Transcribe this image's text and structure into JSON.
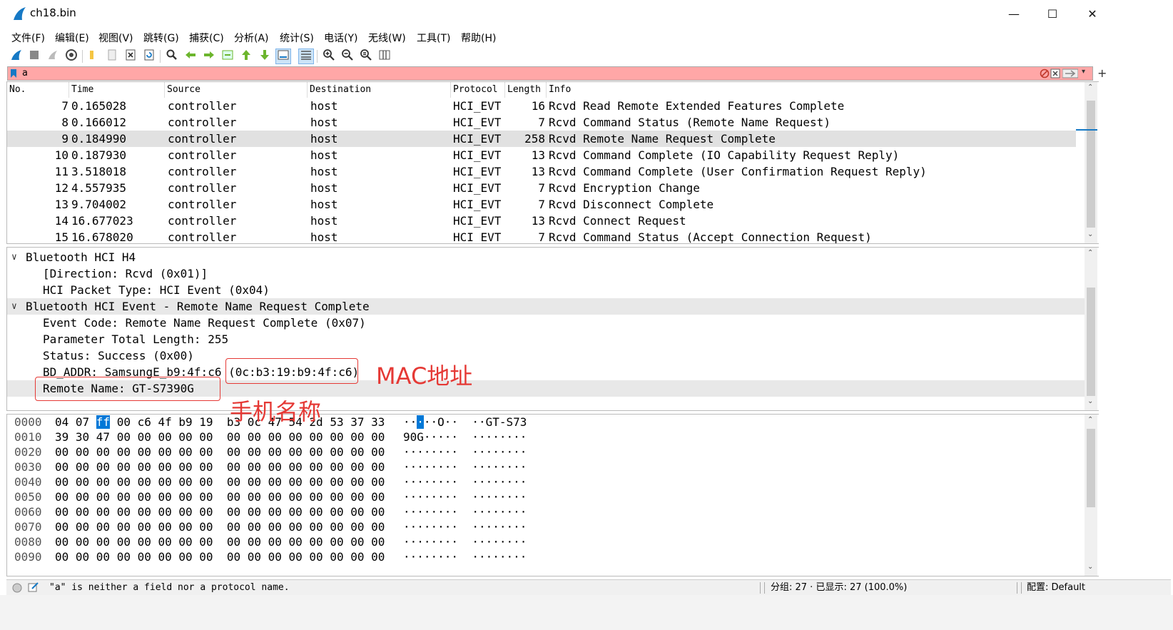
{
  "window": {
    "title": "ch18.bin"
  },
  "menu": [
    "文件(F)",
    "编辑(E)",
    "视图(V)",
    "跳转(G)",
    "捕获(C)",
    "分析(A)",
    "统计(S)",
    "电话(Y)",
    "无线(W)",
    "工具(T)",
    "帮助(H)"
  ],
  "filter": {
    "value": "a"
  },
  "columns": [
    "No.",
    "Time",
    "Source",
    "Destination",
    "Protocol",
    "Length",
    "Info"
  ],
  "packets": [
    {
      "no": "7",
      "time": "0.165028",
      "source": "controller",
      "destination": "host",
      "protocol": "HCI_EVT",
      "length": "16",
      "info": "Rcvd Read Remote Extended Features Complete"
    },
    {
      "no": "8",
      "time": "0.166012",
      "source": "controller",
      "destination": "host",
      "protocol": "HCI_EVT",
      "length": "7",
      "info": "Rcvd Command Status (Remote Name Request)"
    },
    {
      "no": "9",
      "time": "0.184990",
      "source": "controller",
      "destination": "host",
      "protocol": "HCI_EVT",
      "length": "258",
      "info": "Rcvd Remote Name Request Complete"
    },
    {
      "no": "10",
      "time": "0.187930",
      "source": "controller",
      "destination": "host",
      "protocol": "HCI_EVT",
      "length": "13",
      "info": "Rcvd Command Complete (IO Capability Request Reply)"
    },
    {
      "no": "11",
      "time": "3.518018",
      "source": "controller",
      "destination": "host",
      "protocol": "HCI_EVT",
      "length": "13",
      "info": "Rcvd Command Complete (User Confirmation Request Reply)"
    },
    {
      "no": "12",
      "time": "4.557935",
      "source": "controller",
      "destination": "host",
      "protocol": "HCI_EVT",
      "length": "7",
      "info": "Rcvd Encryption Change"
    },
    {
      "no": "13",
      "time": "9.704002",
      "source": "controller",
      "destination": "host",
      "protocol": "HCI_EVT",
      "length": "7",
      "info": "Rcvd Disconnect Complete"
    },
    {
      "no": "14",
      "time": "16.677023",
      "source": "controller",
      "destination": "host",
      "protocol": "HCI_EVT",
      "length": "13",
      "info": "Rcvd Connect Request"
    },
    {
      "no": "15",
      "time": "16.678020",
      "source": "controller",
      "destination": "host",
      "protocol": "HCI_EVT",
      "length": "7",
      "info": "Rcvd Command Status (Accept Connection Request)"
    }
  ],
  "selected_packet_no": "9",
  "details": [
    {
      "text": "Bluetooth HCI H4",
      "level": 0,
      "expanded": true
    },
    {
      "text": "[Direction: Rcvd (0x01)]",
      "level": 1
    },
    {
      "text": "HCI Packet Type: HCI Event (0x04)",
      "level": 1
    },
    {
      "text": "Bluetooth HCI Event - Remote Name Request Complete",
      "level": 0,
      "expanded": true
    },
    {
      "text": "Event Code: Remote Name Request Complete (0x07)",
      "level": 1
    },
    {
      "text": "Parameter Total Length: 255",
      "level": 1
    },
    {
      "text": "Status: Success (0x00)",
      "level": 1
    },
    {
      "text": "BD_ADDR: SamsungE_b9:4f:c6 (0c:b3:19:b9:4f:c6)",
      "level": 1
    },
    {
      "text": "Remote Name: GT-S7390G",
      "level": 1,
      "selected": true
    }
  ],
  "hex": [
    {
      "offset": "0000",
      "bytes": "04 07 ff 00 c6 4f b9 19  b3 0c 47 54 2d 53 37 33",
      "ascii": "·····O··  ··GT-S73"
    },
    {
      "offset": "0010",
      "bytes": "39 30 47 00 00 00 00 00  00 00 00 00 00 00 00 00",
      "ascii": "90G·····  ········"
    },
    {
      "offset": "0020",
      "bytes": "00 00 00 00 00 00 00 00  00 00 00 00 00 00 00 00",
      "ascii": "········  ········"
    },
    {
      "offset": "0030",
      "bytes": "00 00 00 00 00 00 00 00  00 00 00 00 00 00 00 00",
      "ascii": "········  ········"
    },
    {
      "offset": "0040",
      "bytes": "00 00 00 00 00 00 00 00  00 00 00 00 00 00 00 00",
      "ascii": "········  ········"
    },
    {
      "offset": "0050",
      "bytes": "00 00 00 00 00 00 00 00  00 00 00 00 00 00 00 00",
      "ascii": "········  ········"
    },
    {
      "offset": "0060",
      "bytes": "00 00 00 00 00 00 00 00  00 00 00 00 00 00 00 00",
      "ascii": "········  ········"
    },
    {
      "offset": "0070",
      "bytes": "00 00 00 00 00 00 00 00  00 00 00 00 00 00 00 00",
      "ascii": "········  ········"
    },
    {
      "offset": "0080",
      "bytes": "00 00 00 00 00 00 00 00  00 00 00 00 00 00 00 00",
      "ascii": "········  ········"
    },
    {
      "offset": "0090",
      "bytes": "00 00 00 00 00 00 00 00  00 00 00 00 00 00 00 00",
      "ascii": "········  ········"
    }
  ],
  "annotations": {
    "mac": "MAC地址",
    "phone_name": "手机名称"
  },
  "status": {
    "message": "\"a\" is neither a field nor a protocol name.",
    "packets": "分组: 27 · 已显示: 27 (100.0%)",
    "profile": "配置: Default"
  },
  "colors": {
    "filter_invalid": "#ffa7a7",
    "selection": "#e1e1e1",
    "annotation": "#e53935",
    "hex_select": "#0078d7"
  }
}
